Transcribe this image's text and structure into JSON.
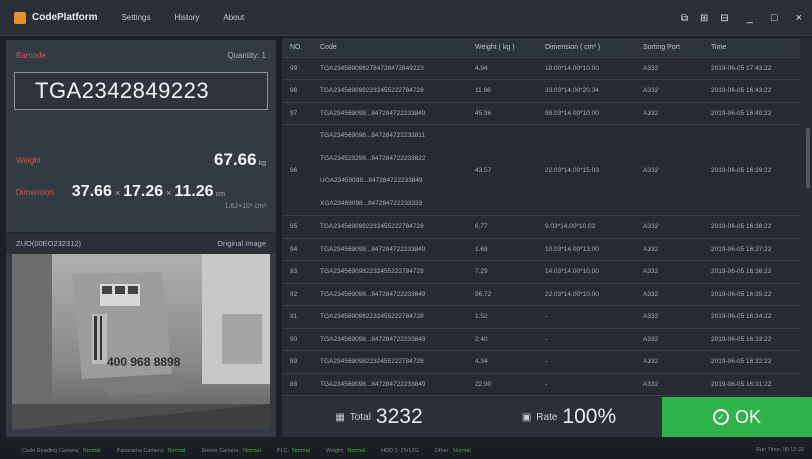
{
  "app": {
    "title": "CodePlatform",
    "menu": [
      "Settings",
      "History",
      "About"
    ]
  },
  "window_controls": [
    "⧉",
    "⊞",
    "⊟",
    "_",
    "□",
    "×"
  ],
  "left": {
    "barcode_label": "Barcode",
    "quantity": "Quantity: 1",
    "barcode": "TGA2342849223",
    "weight_label": "Weight",
    "weight_value": "67.66",
    "weight_unit": "kg",
    "dimension_label": "Dimension",
    "dim_l": "37.66",
    "dim_w": "17.26",
    "dim_h": "11.26",
    "dim_x": "×",
    "dim_unit": "cm",
    "volume": "1.62×10³ cm³",
    "camera_id": "ZUO(00EO232312)",
    "camera_label": "Original Image",
    "camera_box_text": "400 968 8898"
  },
  "table": {
    "headers": [
      "NO.",
      "Code",
      "Weight ( kg )",
      "Dimension ( cm³ )",
      "Sorting Port",
      "Time"
    ],
    "rows": [
      {
        "no": "99",
        "code": "TGA2345690982784728472849223",
        "weight": "4.94",
        "dim": "18.00*14.00*10.00",
        "port": "A332",
        "time": "2019-06-05 17:43:22"
      },
      {
        "no": "98",
        "code": "TGA2345690982232455222784728",
        "weight": "11.96",
        "dim": "33.03*14.00*20.34",
        "port": "A332",
        "time": "2019-06-05 16:43:22"
      },
      {
        "no": "97",
        "code": "TGA234569098...847284722233849",
        "weight": "45.96",
        "dim": "99.03*14.00*10.00",
        "port": "A332",
        "time": "2019-06-05 16:40:22"
      }
    ],
    "multi": {
      "no": "96",
      "codes": [
        "TGA234569098...847284722233811",
        "TGA234523298...847284722233822",
        "UGA23459098...847284722233849",
        "XGA23469098...847284722233333"
      ],
      "weight": "43.57",
      "dim": "22.03*14.00*15.03",
      "port": "A332",
      "time": "2019-06-05 16:39:22"
    },
    "rows2": [
      {
        "no": "95",
        "code": "TGA2345690982232455222784728",
        "weight": "6.77",
        "dim": "9.03*14.00*10.03",
        "port": "A332",
        "time": "2019-06-05 16:38:22"
      },
      {
        "no": "94",
        "code": "TGA234569098...847284722233849",
        "weight": "1.69",
        "dim": "10.03*14.00*13.00",
        "port": "A332",
        "time": "2019-06-05 16:37:22"
      },
      {
        "no": "93",
        "code": "TGA2345690982232455222784728",
        "weight": "7.29",
        "dim": "14.03*14.00*10.00",
        "port": "A332",
        "time": "2019-06-05 16:36:22"
      },
      {
        "no": "92",
        "code": "TGA234569098...847284722233849",
        "weight": "96.72",
        "dim": "22.03*14.00*10.00",
        "port": "A332",
        "time": "2019-06-05 16:35:22"
      },
      {
        "no": "91",
        "code": "TGA2345690982232455222784728",
        "weight": "1.52",
        "dim": "-",
        "port": "A332",
        "time": "2019-06-05 16:34:22"
      },
      {
        "no": "90",
        "code": "TGA234569098...847284722233849",
        "weight": "2.40",
        "dim": "-",
        "port": "A332",
        "time": "2019-06-05 16:33:22"
      },
      {
        "no": "89",
        "code": "TGA2345690982232455222784728",
        "weight": "4.34",
        "dim": "-",
        "port": "A332",
        "time": "2019-06-05 16:32:22"
      },
      {
        "no": "88",
        "code": "TGA234569098...847284722233849",
        "weight": "22.90",
        "dim": "-",
        "port": "A332",
        "time": "2019-06-05 16:31:22"
      }
    ]
  },
  "counter": {
    "total_label": "Total",
    "total": "3232",
    "rate_label": "Rate",
    "rate": "100%",
    "ok": "OK",
    "ok_symbol": "✓",
    "total_icon": "▦",
    "rate_icon": "▣"
  },
  "status": {
    "items": [
      {
        "label": "Code Reading Camera:",
        "value": "Normal"
      },
      {
        "label": "Panorama Camera:",
        "value": "Normal"
      },
      {
        "label": "Stereo Camera:",
        "value": "Normal"
      },
      {
        "label": "PLC:",
        "value": "Normal"
      },
      {
        "label": "Weight:",
        "value": "Normal"
      },
      {
        "label": "HDD 1: 25/12G",
        "value": ""
      },
      {
        "label": "Other:",
        "value": "Normal"
      }
    ],
    "runtime": "Run Time: 00:12:22"
  }
}
